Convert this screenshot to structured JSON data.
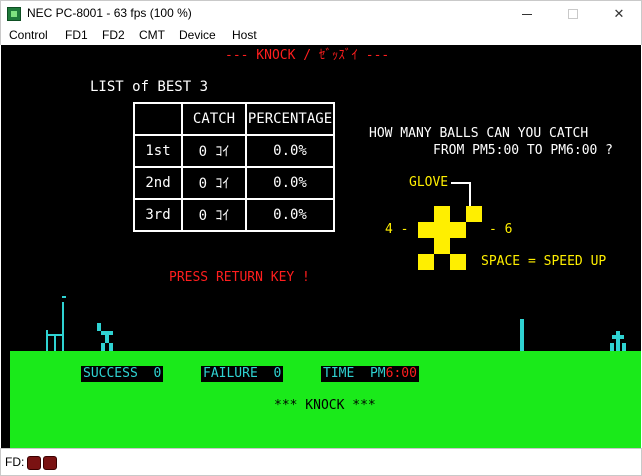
{
  "window": {
    "title": "NEC PC-8001 - 63 fps (100 %)",
    "icon": "pc-8001-icon",
    "controls": [
      "minimize",
      "maximize",
      "close"
    ]
  },
  "menu": [
    "Control",
    "FD1",
    "FD2",
    "CMT",
    "Device",
    "Host"
  ],
  "game": {
    "header": "--- KNOCK / ｾﾞｯｽﾞｲ ---",
    "best_list_title": "LIST of BEST 3",
    "table": {
      "headers": [
        "",
        "CATCH",
        "PERCENTAGE"
      ],
      "rows": [
        [
          "1st",
          "0 ｺｲ",
          "0.0%"
        ],
        [
          "2nd",
          "0 ｺｲ",
          "0.0%"
        ],
        [
          "3rd",
          "0 ｺｲ",
          "0.0%"
        ]
      ]
    },
    "question_line1": "HOW MANY BALLS CAN YOU CATCH",
    "question_line2": "FROM PM5:00 TO PM6:00 ?",
    "glove_label": "GLOVE",
    "left_key": "4 -",
    "right_key": "- 6",
    "speed_hint": "SPACE = SPEED UP",
    "press_return": "PRESS RETURN KEY !",
    "hud": {
      "success_label": "SUCCESS",
      "success_value": "0",
      "failure_label": "FAILURE",
      "failure_value": "0",
      "time_label": "TIME",
      "time_prefix": "PM",
      "time_value": "6:00"
    },
    "footer": "*** KNOCK ***",
    "colors": {
      "background": "#000000",
      "field": "#1aea1a",
      "accent_red": "#ff1e1e",
      "glove_yellow": "#ffef00",
      "hud_cyan": "#2fd2d2"
    }
  },
  "status": {
    "fd_label": "FD:",
    "drive_leds": 2
  }
}
